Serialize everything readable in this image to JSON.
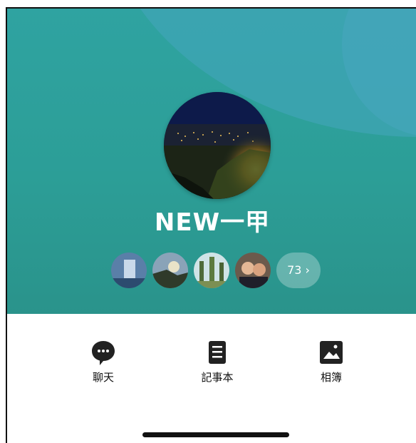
{
  "profile": {
    "name": "NEW一甲",
    "photo_icon": "night-city-photo"
  },
  "friends": {
    "count_label": "73",
    "chevron": "›",
    "avatars": [
      "friend-avatar-1",
      "friend-avatar-2",
      "friend-avatar-3",
      "friend-avatar-4"
    ]
  },
  "actions": [
    {
      "label": "聊天",
      "icon": "chat-bubble-icon"
    },
    {
      "label": "記事本",
      "icon": "notes-icon"
    },
    {
      "label": "相簿",
      "icon": "album-icon"
    }
  ],
  "colors": {
    "header_bg": "#2fa3a1",
    "swoosh": "#46a5be",
    "icon_dark": "#222222"
  }
}
